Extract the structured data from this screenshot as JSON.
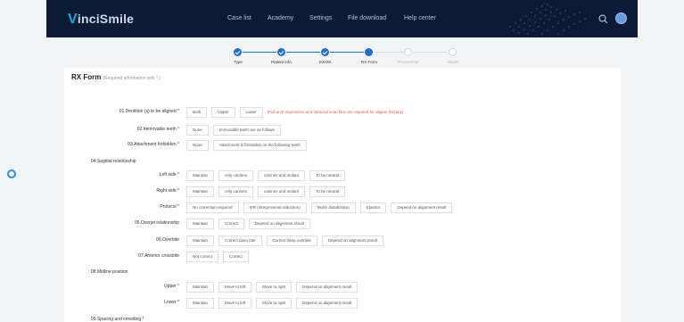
{
  "app": {
    "logo_letter": "V",
    "logo_rest": "inciSmile"
  },
  "nav": [
    {
      "label": "Case list"
    },
    {
      "label": "Academy"
    },
    {
      "label": "Settings"
    },
    {
      "label": "File download"
    },
    {
      "label": "Help center"
    }
  ],
  "header_icons": {
    "search": "search-icon",
    "avatar": "avatar"
  },
  "stepper": [
    {
      "label": "Type",
      "state": "done"
    },
    {
      "label": "Patient info.",
      "state": "done"
    },
    {
      "label": "EXAM.",
      "state": "done"
    },
    {
      "label": "RX Form",
      "state": "current"
    },
    {
      "label": "Photos/Imgs",
      "state": "todo"
    },
    {
      "label": "Model",
      "state": "todo"
    }
  ],
  "form": {
    "title": "RX Form",
    "subtitle": "(Required information with *.)"
  },
  "rows": [
    {
      "label": "01.Dentition (s) to be aligned *",
      "options": [
        "Both",
        "Upper",
        "Lower"
      ],
      "note": "(Full arch impression and intraoral scan files are required for aligner therapy)"
    },
    {
      "label": "02.Immovable teeth *",
      "options": [
        "None",
        "Immovable teeth are as follows"
      ]
    },
    {
      "label": "03.Attachment forbidden *",
      "options": [
        "None",
        "Attachment is forbidden on the following teeth"
      ]
    },
    {
      "label": "04.Sagittal relationship",
      "options": [],
      "heading": true
    },
    {
      "label": "Left side *",
      "options": [
        "Maintain",
        "only canines",
        "canines and molars",
        "To be neutral"
      ]
    },
    {
      "label": "Right side *",
      "options": [
        "Maintain",
        "only canines",
        "canines and molars",
        "To be neutral"
      ]
    },
    {
      "label": "Protocol *",
      "options": [
        "No correction required",
        "IPR (interproximal reduction)",
        "Molar distalization",
        "Elastics",
        "Depend on alignment result"
      ]
    },
    {
      "label": "05.Overjet relationship",
      "options": [
        "Maintain",
        "Correct",
        "Depend on alignment result"
      ]
    },
    {
      "label": "06.Overbite",
      "options": [
        "Maintain",
        "Correct open bite",
        "Correct deep overbite",
        "Depend on alignment result"
      ]
    },
    {
      "label": "07.Anterior crossbite",
      "options": [
        "Not correct",
        "Correct"
      ]
    },
    {
      "label": "08.Midline position",
      "options": [],
      "heading": true
    },
    {
      "label": "Upper *",
      "options": [
        "Maintain",
        "Move to left",
        "Move to right",
        "Depend on alignment result"
      ]
    },
    {
      "label": "Lower *",
      "options": [
        "Maintain",
        "Move to left",
        "Move to right",
        "Depend on alignment result"
      ]
    },
    {
      "label": "09.Spacing and crowding *",
      "options": [],
      "heading": true
    }
  ],
  "colors": {
    "header_bg": "#0d1a35",
    "accent": "#1f6fd0",
    "note": "#e55a3c"
  }
}
